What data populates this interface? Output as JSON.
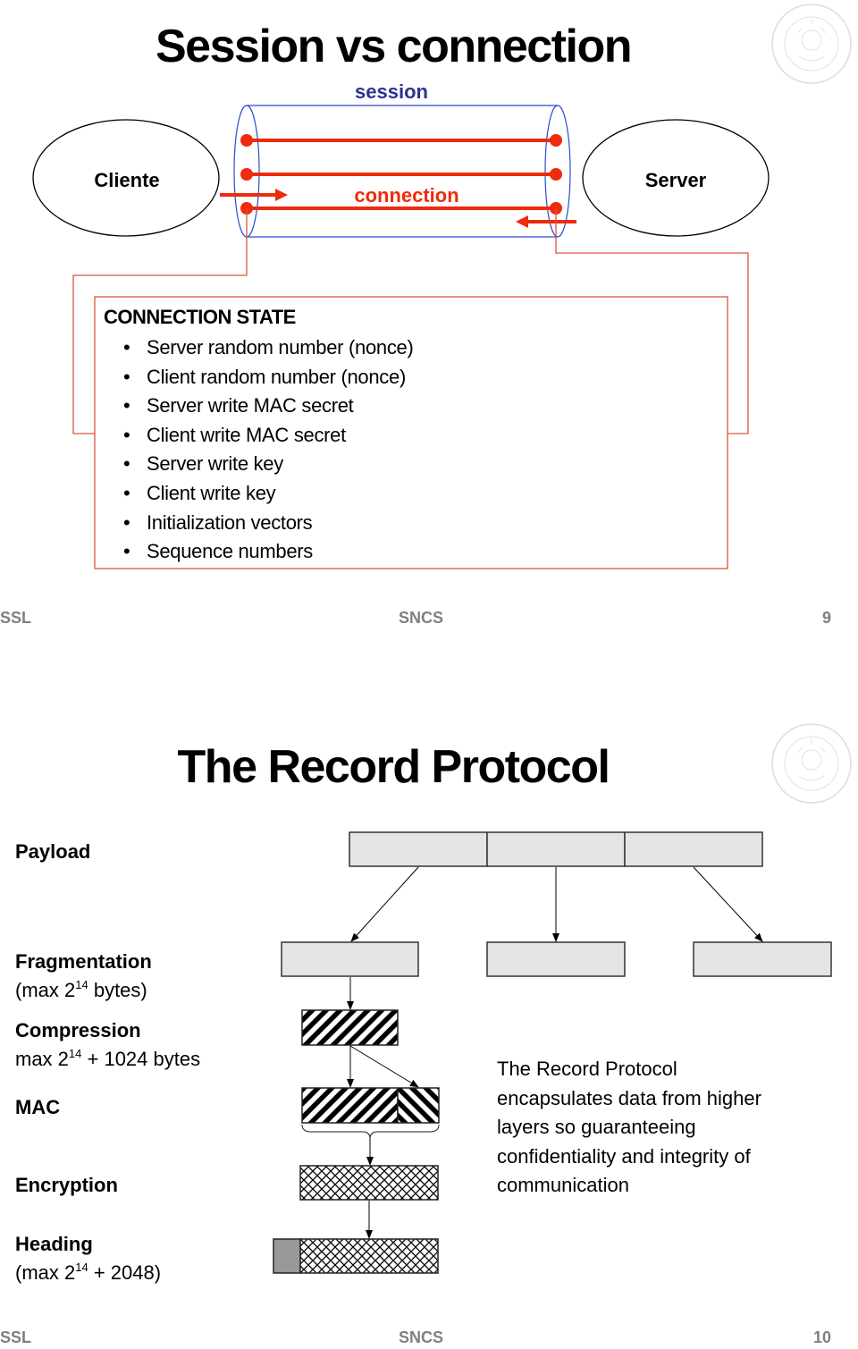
{
  "slides": [
    {
      "title": "Session vs connection",
      "diagram": {
        "session_label": "session",
        "connection_label": "connection",
        "client_label": "Cliente",
        "server_label": "Server",
        "connection_count": 3
      },
      "connection_state": {
        "title": "CONNECTION STATE",
        "items": [
          "Server random number (nonce)",
          "Client random number (nonce)",
          "Server write MAC secret",
          "Client write MAC secret",
          "Server write key",
          "Client write key",
          "Initialization vectors",
          "Sequence numbers"
        ]
      },
      "footer": {
        "left": "SSL",
        "center": "SNCS",
        "page": "9"
      }
    },
    {
      "title": "The Record Protocol",
      "steps": {
        "payload": {
          "name": "Payload"
        },
        "fragmentation": {
          "name": "Fragmentation",
          "detail_prefix": "(max 2",
          "detail_exp": "14",
          "detail_suffix": " bytes)"
        },
        "compression": {
          "name": "Compression",
          "detail_prefix": "max 2",
          "detail_exp": "14",
          "detail_suffix": " + 1024 bytes"
        },
        "mac": {
          "name": "MAC"
        },
        "encryption": {
          "name": "Encryption"
        },
        "heading": {
          "name": "Heading",
          "detail_prefix": "(max 2",
          "detail_exp": "14",
          "detail_suffix": " + 2048)"
        }
      },
      "description": [
        "The Record Protocol",
        "encapsulates data from higher",
        "layers so guaranteeing",
        "confidentiality and integrity of",
        "communication"
      ],
      "footer": {
        "left": "SSL",
        "center": "SNCS",
        "page": "10"
      }
    }
  ],
  "colors": {
    "title": "#000000",
    "session_blue": "#2e3192",
    "cylinder_blue": "#2b4bd1",
    "connection_red": "#ee2b0c",
    "state_border": "#e0533a",
    "footer_gray": "#7f7f7f",
    "box_fill": "#e4e4e4",
    "header_fill": "#999999"
  }
}
